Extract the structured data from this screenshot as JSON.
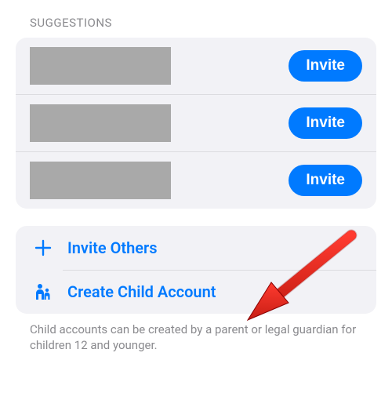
{
  "section_header": "SUGGESTIONS",
  "suggestions": [
    {
      "invite_label": "Invite"
    },
    {
      "invite_label": "Invite"
    },
    {
      "invite_label": "Invite"
    }
  ],
  "actions": {
    "invite_others_label": "Invite Others",
    "create_child_label": "Create Child Account"
  },
  "footer_text": "Child accounts can be created by a parent or legal guardian for children 12 and younger.",
  "colors": {
    "accent": "#007aff",
    "card_bg": "#f2f2f6",
    "placeholder": "#a9a9a9",
    "muted_text": "#8a8a8e"
  }
}
